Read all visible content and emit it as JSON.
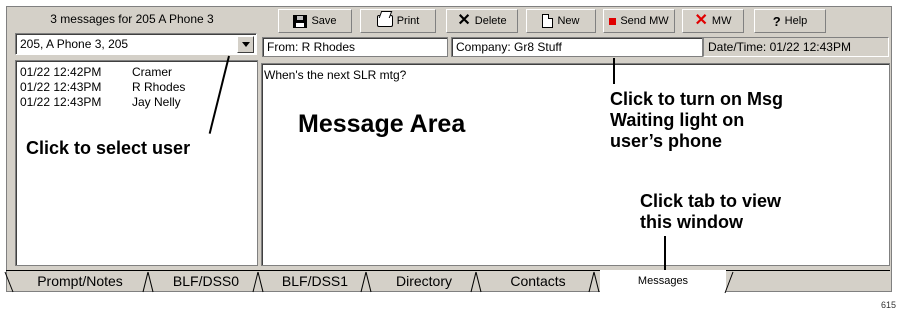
{
  "left_panel": {
    "count_label": "3 messages for 205 A Phone 3",
    "user_select": "205, A Phone 3, 205",
    "messages": [
      {
        "time": "01/22 12:42PM",
        "from": "Cramer"
      },
      {
        "time": "01/22 12:43PM",
        "from": "R Rhodes"
      },
      {
        "time": "01/22 12:43PM",
        "from": "Jay Nelly"
      }
    ]
  },
  "toolbar": {
    "save": "Save",
    "print": "Print",
    "delete": "Delete",
    "new": "New",
    "send_mw": "Send MW",
    "mw": "MW",
    "help": "Help"
  },
  "header": {
    "from": "From: R Rhodes",
    "company": "Company: Gr8 Stuff",
    "datetime": "Date/Time: 01/22 12:43PM"
  },
  "message": {
    "text": "When's the next SLR mtg?"
  },
  "annotations": {
    "select_user": "Click to select user",
    "message_area": "Message Area",
    "msg_waiting_1": "Click to turn on Msg",
    "msg_waiting_2": "Waiting light on",
    "msg_waiting_3": "user’s phone",
    "tab_view_1": "Click tab to view",
    "tab_view_2": "this window"
  },
  "tabs": [
    "Prompt/Notes",
    "BLF/DSS0",
    "BLF/DSS1",
    "Directory",
    "Contacts",
    "Messages"
  ],
  "active_tab": "Messages",
  "figure_number": "615"
}
